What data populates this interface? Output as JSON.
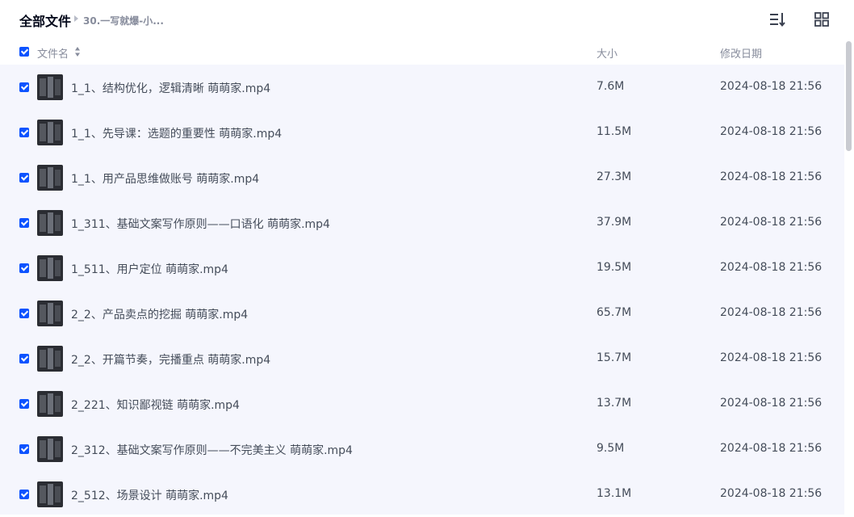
{
  "breadcrumb": {
    "root": "全部文件",
    "current": "30.一写就爆-小..."
  },
  "columns": {
    "name": "文件名",
    "size": "大小",
    "date": "修改日期"
  },
  "files": [
    {
      "name": "1_1、结构优化，逻辑清晰 萌萌家.mp4",
      "size": "7.6M",
      "date": "2024-08-18 21:56"
    },
    {
      "name": "1_1、先导课：选题的重要性 萌萌家.mp4",
      "size": "11.5M",
      "date": "2024-08-18 21:56"
    },
    {
      "name": "1_1、用产品思维做账号 萌萌家.mp4",
      "size": "27.3M",
      "date": "2024-08-18 21:56"
    },
    {
      "name": "1_311、基础文案写作原则——口语化 萌萌家.mp4",
      "size": "37.9M",
      "date": "2024-08-18 21:56"
    },
    {
      "name": "1_511、用户定位 萌萌家.mp4",
      "size": "19.5M",
      "date": "2024-08-18 21:56"
    },
    {
      "name": "2_2、产品卖点的挖掘 萌萌家.mp4",
      "size": "65.7M",
      "date": "2024-08-18 21:56"
    },
    {
      "name": "2_2、开篇节奏，完播重点 萌萌家.mp4",
      "size": "15.7M",
      "date": "2024-08-18 21:56"
    },
    {
      "name": "2_221、知识鄙视链 萌萌家.mp4",
      "size": "13.7M",
      "date": "2024-08-18 21:56"
    },
    {
      "name": "2_312、基础文案写作原则——不完美主义 萌萌家.mp4",
      "size": "9.5M",
      "date": "2024-08-18 21:56"
    },
    {
      "name": "2_512、场景设计 萌萌家.mp4",
      "size": "13.1M",
      "date": "2024-08-18 21:56"
    }
  ],
  "icons": {
    "sort": "sort-list-icon",
    "grid": "grid-view-icon",
    "file": "video-thumbnail"
  },
  "colors": {
    "accent": "#0d53ff",
    "row_bg": "#f5f6fd",
    "text": "#454d5a",
    "muted": "#878c9c"
  }
}
